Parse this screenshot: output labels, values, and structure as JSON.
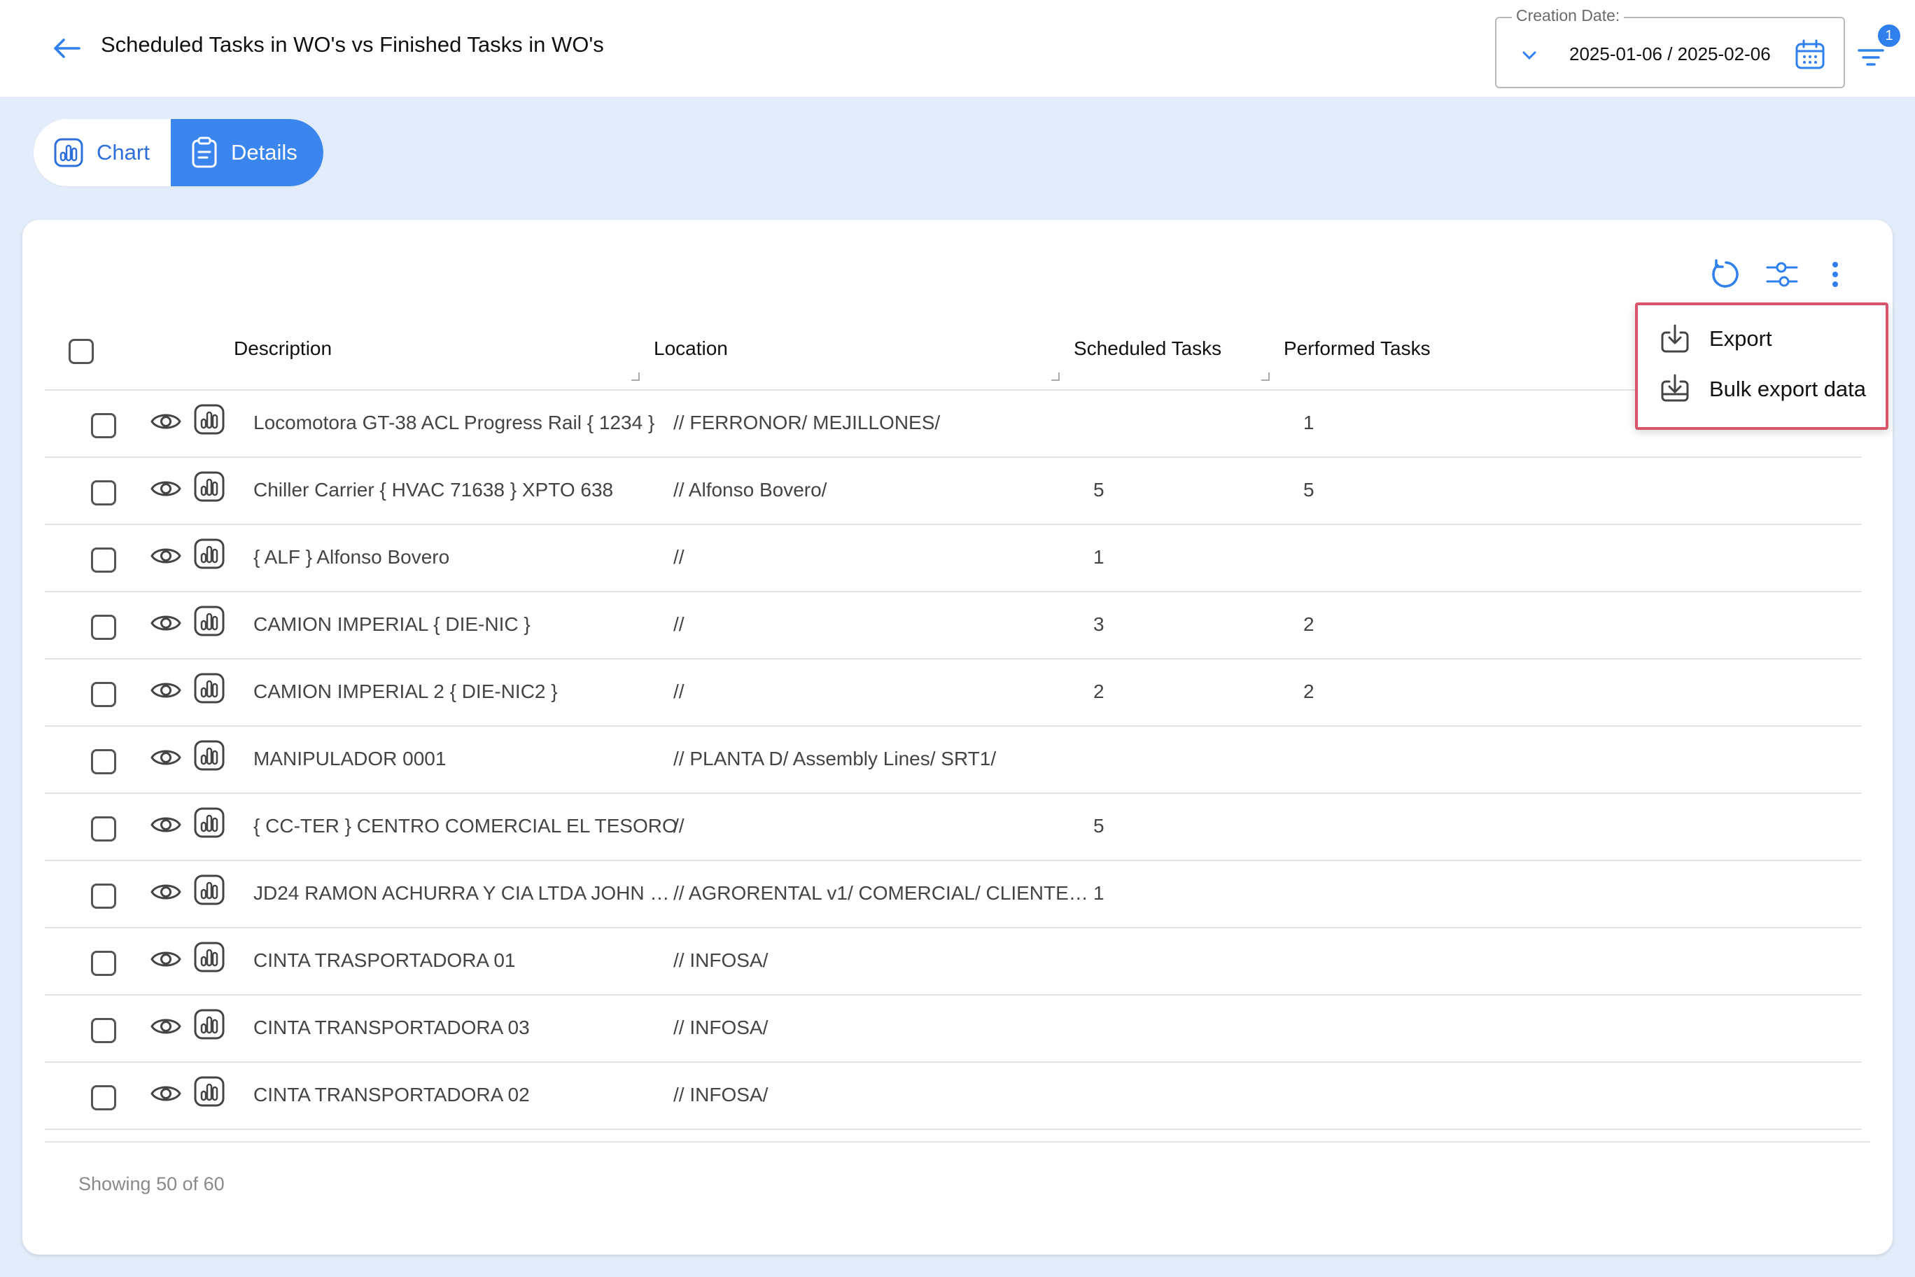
{
  "header": {
    "title": "Scheduled Tasks in WO's vs Finished Tasks in WO's",
    "date_label": "Creation Date:",
    "date_value": "2025-01-06 / 2025-02-06",
    "filter_badge": "1"
  },
  "tabs": [
    {
      "label": "Chart",
      "active": false
    },
    {
      "label": "Details",
      "active": true
    }
  ],
  "table": {
    "columns": [
      "Description",
      "Location",
      "Scheduled Tasks",
      "Performed Tasks"
    ],
    "rows": [
      {
        "description": "Locomotora GT-38 ACL Progress Rail { 1234 }",
        "location": "// FERRONOR/ MEJILLONES/",
        "scheduled": "",
        "performed": "1"
      },
      {
        "description": "Chiller Carrier { HVAC 71638 } XPTO 638",
        "location": "// Alfonso Bovero/",
        "scheduled": "5",
        "performed": "5"
      },
      {
        "description": "{ ALF } Alfonso Bovero",
        "location": "//",
        "scheduled": "1",
        "performed": ""
      },
      {
        "description": "CAMION IMPERIAL { DIE-NIC }",
        "location": "//",
        "scheduled": "3",
        "performed": "2"
      },
      {
        "description": "CAMION IMPERIAL 2 { DIE-NIC2 }",
        "location": "//",
        "scheduled": "2",
        "performed": "2"
      },
      {
        "description": "MANIPULADOR 0001",
        "location": "// PLANTA D/ Assembly Lines/ SRT1/",
        "scheduled": "",
        "performed": ""
      },
      {
        "description": "{ CC-TER } CENTRO COMERCIAL EL TESORO",
        "location": "//",
        "scheduled": "5",
        "performed": ""
      },
      {
        "description": "JD24 RAMON ACHURRA Y CIA LTDA JOHN …",
        "location": "// AGRORENTAL v1/ COMERCIAL/ CLIENTE…",
        "scheduled": "1",
        "performed": ""
      },
      {
        "description": "CINTA TRASPORTADORA 01",
        "location": "// INFOSA/",
        "scheduled": "",
        "performed": ""
      },
      {
        "description": "CINTA TRANSPORTADORA 03",
        "location": "// INFOSA/",
        "scheduled": "",
        "performed": ""
      },
      {
        "description": "CINTA TRANSPORTADORA 02",
        "location": "// INFOSA/",
        "scheduled": "",
        "performed": ""
      }
    ],
    "footer": "Showing 50 of 60"
  },
  "menu": {
    "items": [
      {
        "label": "Export",
        "icon": "download-icon"
      },
      {
        "label": "Bulk export data",
        "icon": "bulk-download-icon"
      }
    ]
  },
  "colors": {
    "accent": "#3b86ee",
    "background": "#e3ecfb",
    "menu_highlight": "#d9546a"
  }
}
